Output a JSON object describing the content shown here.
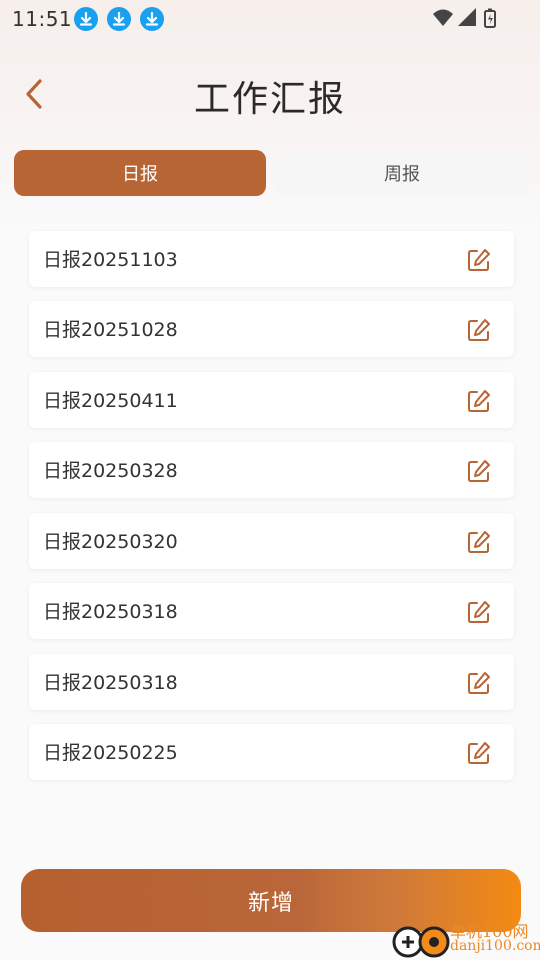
{
  "status_bar": {
    "time": "11:51",
    "download_icon_color": "#1aa0f0"
  },
  "header": {
    "title": "工作汇报",
    "back_icon": "chevron-left-icon",
    "accent_color": "#b86535"
  },
  "tabs": [
    {
      "label": "日报",
      "active": true
    },
    {
      "label": "周报",
      "active": false
    }
  ],
  "reports": [
    {
      "title": "日报20251103"
    },
    {
      "title": "日报20251028"
    },
    {
      "title": "日报20250411"
    },
    {
      "title": "日报20250328"
    },
    {
      "title": "日报20250320"
    },
    {
      "title": "日报20250318"
    },
    {
      "title": "日报20250318"
    },
    {
      "title": "日报20250225"
    }
  ],
  "add_button": {
    "label": "新增"
  },
  "watermark": {
    "brand": "单机100网",
    "url": "danji100.com"
  }
}
